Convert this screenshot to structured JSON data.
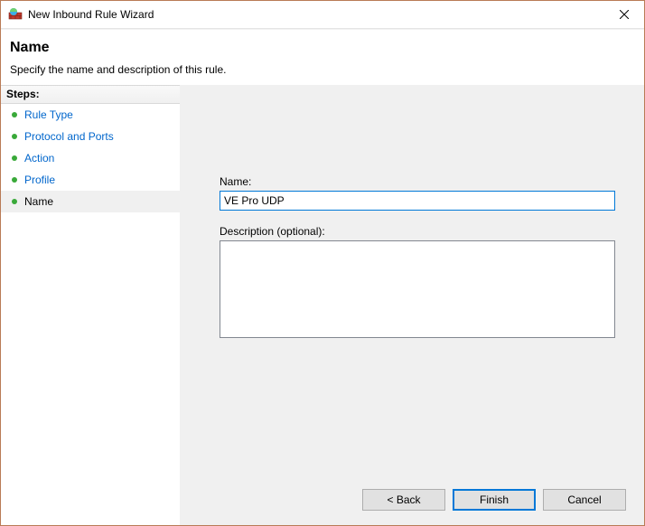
{
  "window": {
    "title": "New Inbound Rule Wizard"
  },
  "header": {
    "title": "Name",
    "subtitle": "Specify the name and description of this rule."
  },
  "sidebar": {
    "header": "Steps:",
    "steps": {
      "rule_type": "Rule Type",
      "protocol_ports": "Protocol and Ports",
      "action": "Action",
      "profile": "Profile",
      "name": "Name"
    }
  },
  "form": {
    "name_label": "Name:",
    "name_value": "VE Pro UDP",
    "desc_label": "Description (optional):",
    "desc_value": ""
  },
  "buttons": {
    "back": "< Back",
    "finish": "Finish",
    "cancel": "Cancel"
  }
}
